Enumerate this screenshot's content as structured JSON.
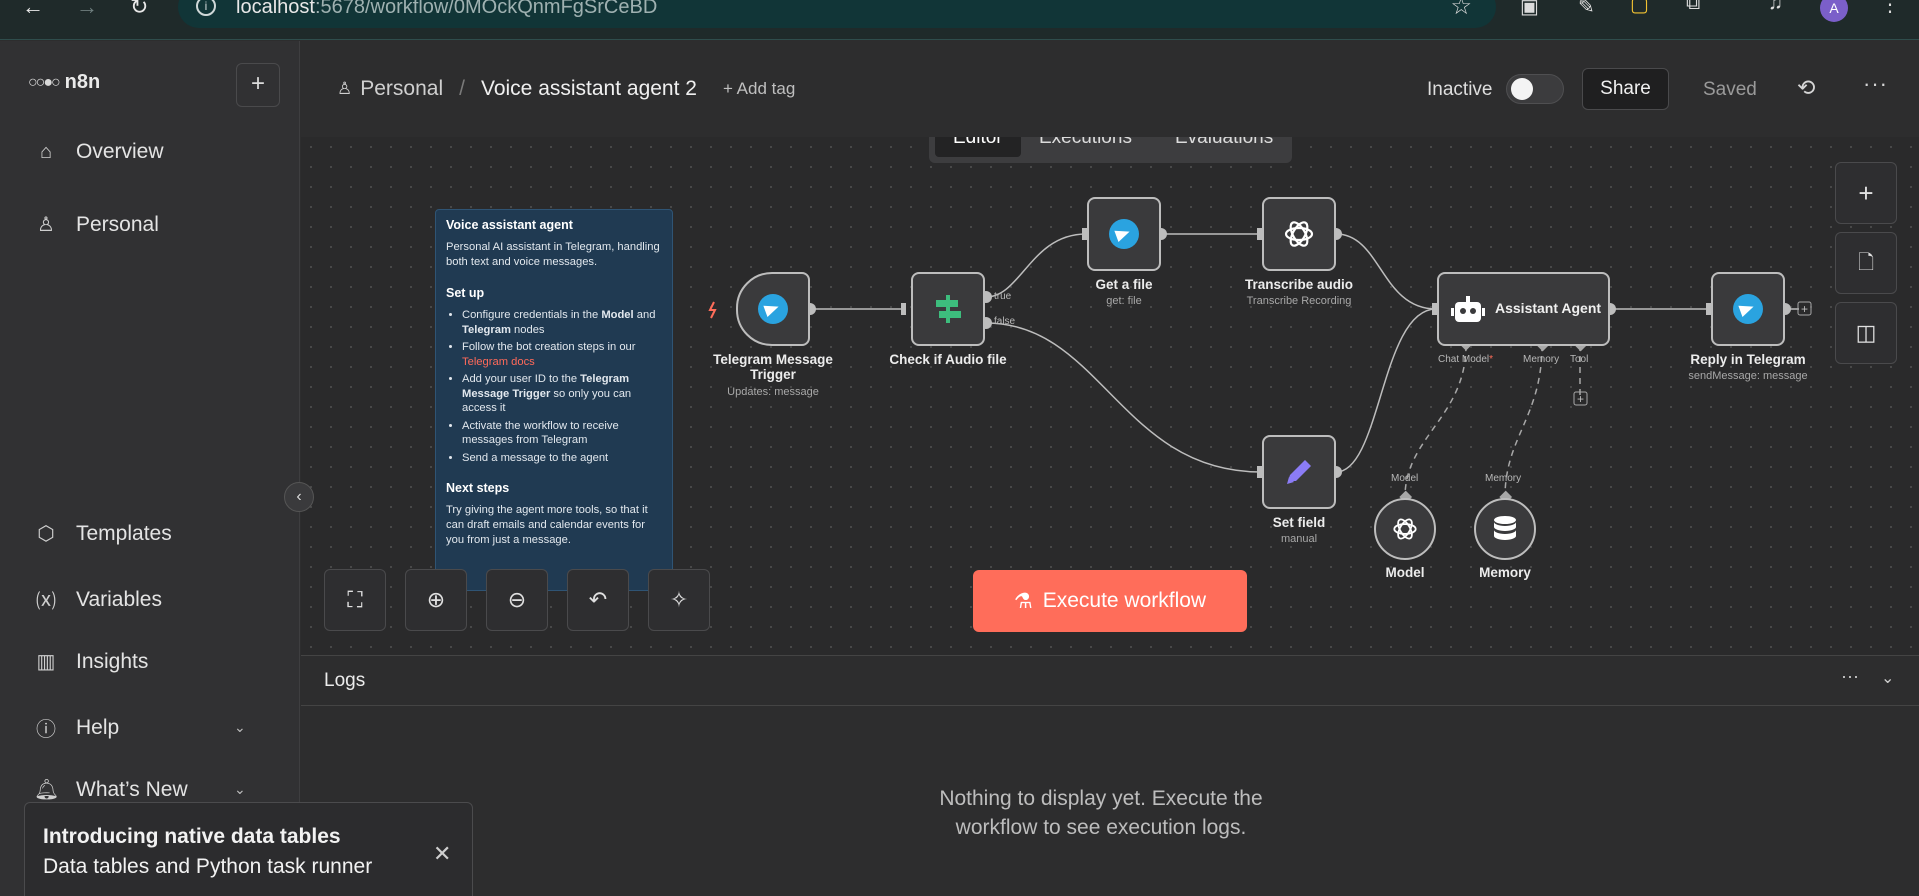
{
  "browser": {
    "back": "←",
    "forward": "→",
    "reload": "↻",
    "url_host": "localhost",
    "url_path": ":5678/workflow/0MOckQnmFgSrCeBD",
    "avatar_letter": "A"
  },
  "sidebar": {
    "brand": "n8n",
    "add_label": "+",
    "items": [
      {
        "label": "Overview",
        "icon": "home-icon"
      },
      {
        "label": "Personal",
        "icon": "user-icon"
      },
      {
        "label": "Templates",
        "icon": "box-icon"
      },
      {
        "label": "Variables",
        "icon": "variable-icon"
      },
      {
        "label": "Insights",
        "icon": "chart-icon"
      },
      {
        "label": "Help",
        "icon": "help-icon"
      },
      {
        "label": "What’s New",
        "icon": "bell-icon"
      }
    ]
  },
  "toast": {
    "title": "Introducing native data tables",
    "body": "Data tables and Python task runner",
    "close": "✕"
  },
  "header": {
    "project": "Personal",
    "workflow_name": "Voice assistant agent 2",
    "add_tag": "+ Add tag",
    "status": "Inactive",
    "share": "Share",
    "saved": "Saved"
  },
  "tabs": [
    "Editor",
    "Executions",
    "Evaluations"
  ],
  "sticky": {
    "title": "Voice assistant agent",
    "intro": "Personal AI assistant in Telegram, handling both text and voice messages.",
    "setup_title": "Set up",
    "setup": {
      "b1_pre": "Configure credentials in the ",
      "b1_model": "Model",
      "b1_mid": " and ",
      "b1_tg": "Telegram",
      "b1_post": " nodes",
      "b2_pre": "Follow the bot creation steps in our ",
      "b2_link": "Telegram docs",
      "b3_pre": "Add your user ID to the ",
      "b3_bold": "Telegram Message Trigger",
      "b3_post": " so only you can access it",
      "b4": "Activate the workflow to receive messages from Telegram",
      "b5": "Send a message to the agent"
    },
    "next_title": "Next steps",
    "next": "Try giving the agent more tools, so that it can draft emails and calendar events for you from just a message."
  },
  "nodes": {
    "trigger": {
      "title": "Telegram Message Trigger",
      "sub": "Updates: message"
    },
    "check": {
      "title": "Check if Audio file",
      "true_label": "true",
      "false_label": "false"
    },
    "getfile": {
      "title": "Get a file",
      "sub": "get: file"
    },
    "transcribe": {
      "title": "Transcribe audio",
      "sub": "Transcribe Recording"
    },
    "agent": {
      "title": "Assistant Agent",
      "chat_model": "Chat Model",
      "required": "*",
      "memory": "Memory",
      "tool": "Tool"
    },
    "reply": {
      "title": "Reply in Telegram",
      "sub": "sendMessage: message"
    },
    "setfield": {
      "title": "Set field",
      "sub": "manual"
    },
    "model": {
      "title": "Model",
      "port": "Model"
    },
    "memory": {
      "title": "Memory",
      "port": "Memory"
    }
  },
  "execute_label": "Execute workflow",
  "logs": {
    "title": "Logs",
    "empty": "Nothing to display yet. Execute the workflow to see execution logs."
  },
  "colors": {
    "accent": "#ff6d5a",
    "telegram": "#2aa3e0",
    "if_green": "#3dbd7d",
    "edit_purple": "#8b7cf6",
    "sticky_bg": "#203a52"
  }
}
